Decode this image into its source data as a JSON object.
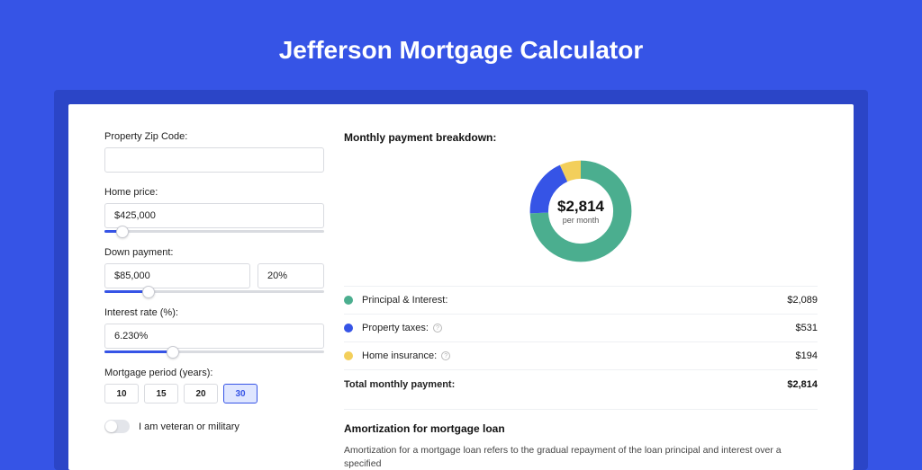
{
  "title": "Jefferson Mortgage Calculator",
  "fields": {
    "zip": {
      "label": "Property Zip Code:",
      "value": ""
    },
    "price": {
      "label": "Home price:",
      "value": "$425,000",
      "slider_pct": 8
    },
    "down": {
      "label": "Down payment:",
      "value": "$85,000",
      "pct": "20%",
      "slider_pct": 20
    },
    "rate": {
      "label": "Interest rate (%):",
      "value": "6.230%",
      "slider_pct": 31
    },
    "period": {
      "label": "Mortgage period (years):",
      "options": [
        "10",
        "15",
        "20",
        "30"
      ],
      "selected": "30"
    },
    "veteran": {
      "label": "I am veteran or military",
      "on": false
    }
  },
  "breakdown": {
    "title": "Monthly payment breakdown:",
    "total_display": "$2,814",
    "per_month": "per month",
    "items": [
      {
        "key": "pi",
        "label": "Principal & Interest:",
        "value": "$2,089",
        "color": "#4bae8f",
        "info": false
      },
      {
        "key": "tax",
        "label": "Property taxes:",
        "value": "$531",
        "color": "#3654e6",
        "info": true
      },
      {
        "key": "ins",
        "label": "Home insurance:",
        "value": "$194",
        "color": "#f3cf5b",
        "info": true
      }
    ],
    "total_label": "Total monthly payment:",
    "total_value": "$2,814"
  },
  "chart_data": {
    "type": "pie",
    "title": "Monthly payment breakdown",
    "series": [
      {
        "name": "Principal & Interest",
        "value": 2089,
        "color": "#4bae8f"
      },
      {
        "name": "Property taxes",
        "value": 531,
        "color": "#3654e6"
      },
      {
        "name": "Home insurance",
        "value": 194,
        "color": "#f3cf5b"
      }
    ],
    "total": 2814,
    "center_label": "$2,814",
    "center_sub": "per month"
  },
  "amort": {
    "title": "Amortization for mortgage loan",
    "text": "Amortization for a mortgage loan refers to the gradual repayment of the loan principal and interest over a specified"
  }
}
